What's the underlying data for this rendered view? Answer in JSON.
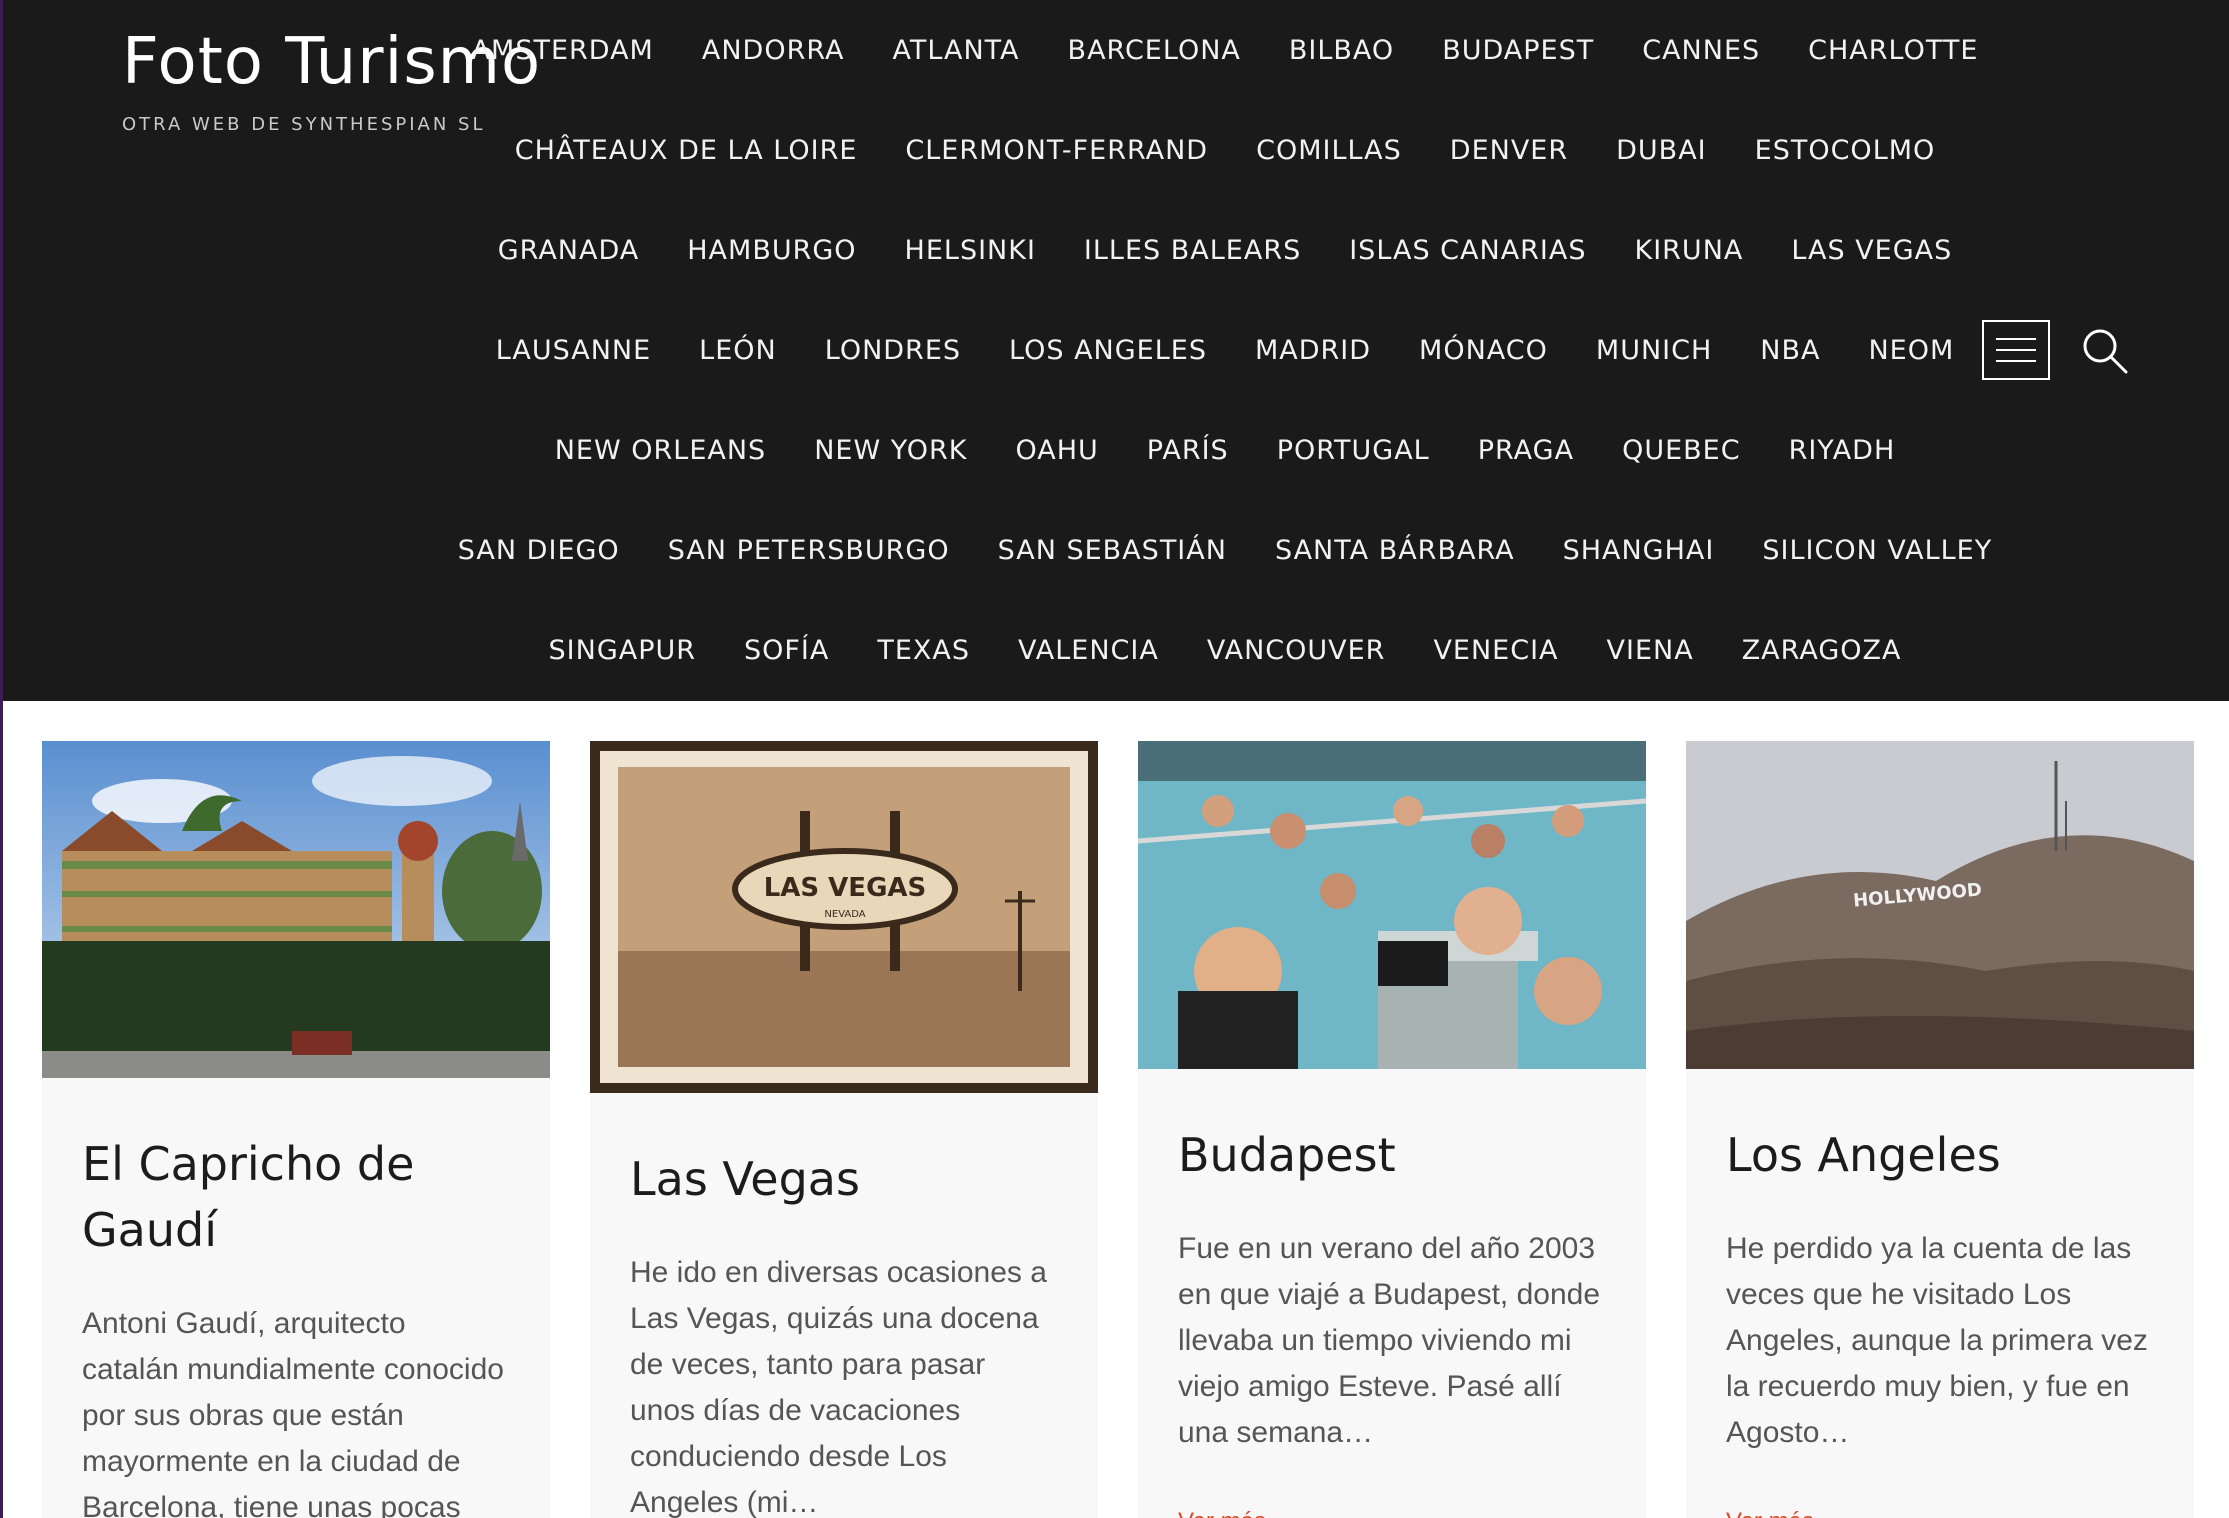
{
  "site": {
    "title": "Foto Turismo",
    "description": "OTRA WEB DE SYNTHESPIAN SL"
  },
  "nav": {
    "rows": [
      [
        "AMSTERDAM",
        "ANDORRA",
        "ATLANTA",
        "BARCELONA",
        "BILBAO",
        "BUDAPEST",
        "CANNES",
        "CHARLOTTE"
      ],
      [
        "CHÂTEAUX DE LA LOIRE",
        "CLERMONT-FERRAND",
        "COMILLAS",
        "DENVER",
        "DUBAI",
        "ESTOCOLMO"
      ],
      [
        "GRANADA",
        "HAMBURGO",
        "HELSINKI",
        "ILLES BALEARS",
        "ISLAS CANARIAS",
        "KIRUNA",
        "LAS VEGAS"
      ],
      [
        "LAUSANNE",
        "LEÓN",
        "LONDRES",
        "LOS ANGELES",
        "MADRID",
        "MÓNACO",
        "MUNICH",
        "NBA",
        "NEOM"
      ],
      [
        "NEW ORLEANS",
        "NEW YORK",
        "OAHU",
        "PARÍS",
        "PORTUGAL",
        "PRAGA",
        "QUEBEC",
        "RIYADH"
      ],
      [
        "SAN DIEGO",
        "SAN PETERSBURGO",
        "SAN SEBASTIÁN",
        "SANTA BÁRBARA",
        "SHANGHAI",
        "SILICON VALLEY"
      ],
      [
        "SINGAPUR",
        "SOFÍA",
        "TEXAS",
        "VALENCIA",
        "VANCOUVER",
        "VENECIA",
        "VIENA",
        "ZARAGOZA"
      ]
    ],
    "menu_icon": "hamburger-menu-icon",
    "search_icon": "search-icon"
  },
  "posts": [
    {
      "title": "El Capricho de Gaudí",
      "excerpt": "Antoni Gaudí, arquitecto catalán mundialmente conocido por sus obras que están mayormente en la ciudad de Barcelona, tiene unas pocas",
      "read_more": "",
      "image": "gaudi-capricho-building-photo"
    },
    {
      "title": "Las Vegas",
      "excerpt": "He ido en diversas ocasiones a Las Vegas, quizás una docena de veces, tanto para pasar unos días de vacaciones conduciendo desde Los Angeles (mi…",
      "read_more": "",
      "image": "las-vegas-sign-vintage-photo",
      "image_text": "LAS VEGAS",
      "image_subtext": "NEVADA"
    },
    {
      "title": "Budapest",
      "excerpt": "Fue en un verano del año 2003 en que viajé a Budapest, donde llevaba un tiempo viviendo mi viejo amigo Esteve. Pasé allí una semana…",
      "read_more": "Ver más »",
      "image": "budapest-thermal-bath-chess-photo"
    },
    {
      "title": "Los Angeles",
      "excerpt": "He perdido ya la cuenta de las veces que he visitado Los Angeles, aunque la primera vez la recuerdo muy bien, y fue en Agosto…",
      "read_more": "Ver más »",
      "image": "hollywood-sign-hills-photo",
      "image_text": "HOLLYWOOD"
    }
  ],
  "colors": {
    "header_bg": "#1a1a1a",
    "card_bg": "#f8f8f8",
    "link_accent": "#d84a2b"
  }
}
